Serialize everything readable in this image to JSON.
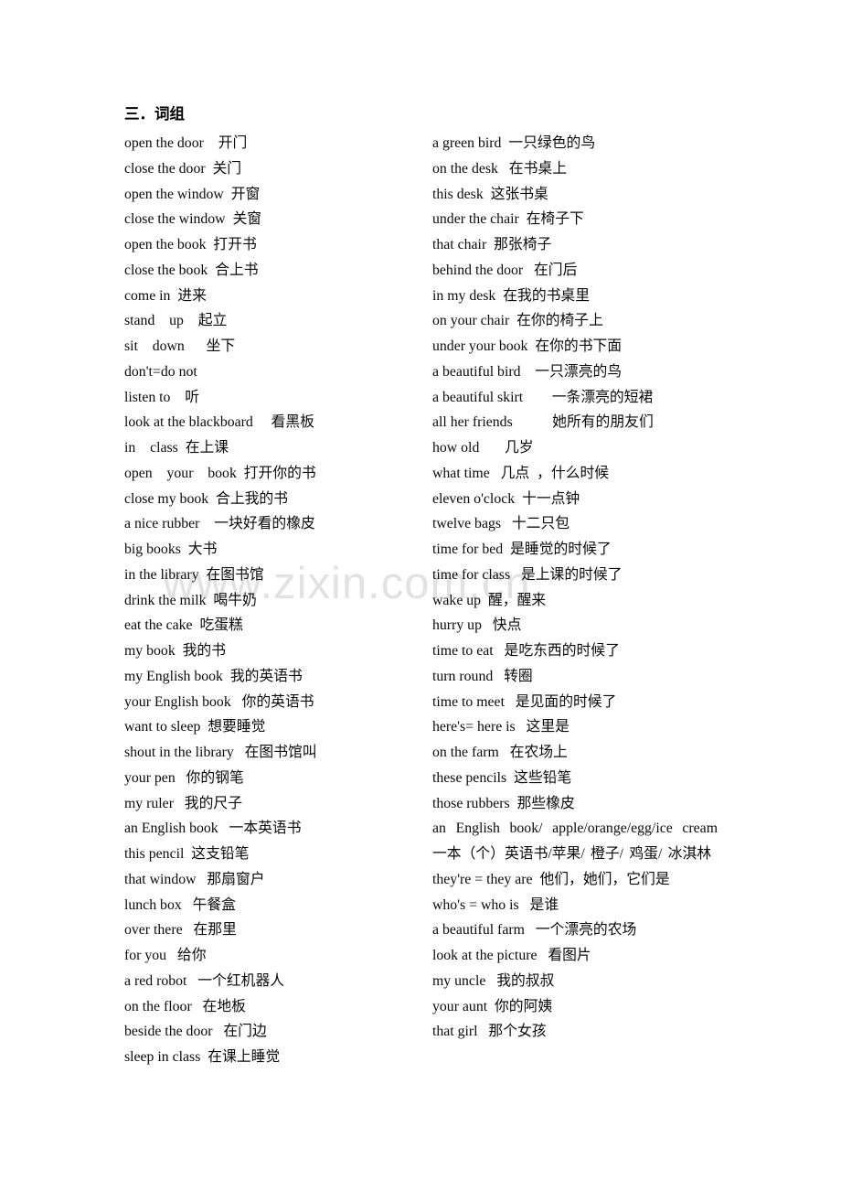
{
  "document": {
    "section_title": "三．词组",
    "watermark": "www.zixin.com.cn",
    "text_color": "#0a0a0a",
    "watermark_color": "#e2e2e2",
    "background_color": "#ffffff"
  },
  "left_column": [
    "open the door    开门",
    "close the door  关门",
    "open the window  开窗",
    "close the window  关窗",
    "open the book  打开书",
    "close the book  合上书",
    "come in  进来",
    "stand    up    起立",
    "sit    down      坐下",
    "don't=do not",
    "listen to    听",
    "look at the blackboard     看黑板",
    "in    class  在上课",
    "open    your    book  打开你的书",
    "close my book  合上我的书",
    "a nice rubber    一块好看的橡皮",
    "big books  大书",
    "in the library  在图书馆",
    "drink the milk  喝牛奶",
    "eat the cake  吃蛋糕",
    "my book  我的书",
    "my English book  我的英语书",
    "your English book   你的英语书",
    "want to sleep  想要睡觉",
    "shout in the library   在图书馆叫",
    "your pen   你的钢笔",
    "my ruler   我的尺子",
    "an English book   一本英语书",
    "this pencil  这支铅笔",
    "that window   那扇窗户",
    "lunch box   午餐盒",
    "over there   在那里",
    "for you   给你",
    "a red robot   一个红机器人",
    "on the floor   在地板",
    "beside the door   在门边",
    "sleep in class  在课上睡觉"
  ],
  "right_column": [
    {
      "text": "a green bird  一只绿色的鸟",
      "justified": false
    },
    {
      "text": "on the desk   在书桌上",
      "justified": false
    },
    {
      "text": "this desk  这张书桌",
      "justified": false
    },
    {
      "text": "under the chair  在椅子下",
      "justified": false
    },
    {
      "text": "that chair  那张椅子",
      "justified": false
    },
    {
      "text": "behind the door   在门后",
      "justified": false
    },
    {
      "text": "in my desk  在我的书桌里",
      "justified": false
    },
    {
      "text": "on your chair  在你的椅子上",
      "justified": false
    },
    {
      "text": "under your book  在你的书下面",
      "justified": false
    },
    {
      "text": "a beautiful bird    一只漂亮的鸟",
      "justified": false
    },
    {
      "text": "a beautiful skirt        一条漂亮的短裙",
      "justified": false
    },
    {
      "text": "all her friends           她所有的朋友们",
      "justified": false
    },
    {
      "text": "how old       几岁",
      "justified": false
    },
    {
      "text": "what time   几点  ，什么时候",
      "justified": false
    },
    {
      "text": "eleven o'clock  十一点钟",
      "justified": false
    },
    {
      "text": "twelve bags   十二只包",
      "justified": false
    },
    {
      "text": "time for bed  是睡觉的时候了",
      "justified": false
    },
    {
      "text": "time for class   是上课的时候了",
      "justified": false
    },
    {
      "text": "wake up  醒，醒来",
      "justified": false
    },
    {
      "text": "hurry up   快点",
      "justified": false
    },
    {
      "text": "time to eat   是吃东西的时候了",
      "justified": false
    },
    {
      "text": "turn round   转圈",
      "justified": false
    },
    {
      "text": "time to meet   是见面的时候了",
      "justified": false
    },
    {
      "text": "here's= here is   这里是",
      "justified": false
    },
    {
      "text": "on the farm   在农场上",
      "justified": false
    },
    {
      "text": "these pencils  这些铅笔",
      "justified": false
    },
    {
      "text": "those rubbers  那些橡皮",
      "justified": false
    },
    {
      "text": "an English book/ apple/orange/egg/ice cream 一本（个）英语书/苹果/ 橙子/ 鸡蛋/ 冰淇林",
      "justified": true
    },
    {
      "text": "they're = they are  他们，她们，它们是",
      "justified": false
    },
    {
      "text": "who's = who is   是谁",
      "justified": false
    },
    {
      "text": "a beautiful farm   一个漂亮的农场",
      "justified": false
    },
    {
      "text": "look at the picture   看图片",
      "justified": false
    },
    {
      "text": "my uncle   我的叔叔",
      "justified": false
    },
    {
      "text": "your aunt  你的阿姨",
      "justified": false
    },
    {
      "text": "that girl   那个女孩",
      "justified": false
    }
  ]
}
